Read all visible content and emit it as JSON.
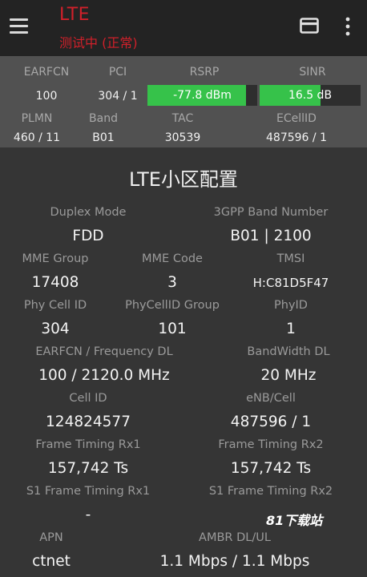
{
  "app": {
    "title": "LTE",
    "status": "测试中 (正常)"
  },
  "icons": {
    "menu": "hamburger-menu-icon",
    "sim": "sim-card-icon",
    "more": "more-vert-icon"
  },
  "colors": {
    "status_red": "#d0202a",
    "meter_green": "#36c24a"
  },
  "stats": {
    "earfcn_label": "EARFCN",
    "earfcn_value": "100",
    "pci_label": "PCI",
    "pci_value": "304 / 1",
    "rsrp_label": "RSRP",
    "rsrp_value": "-77.8 dBm",
    "rsrp_level": 0.9,
    "sinr_label": "SINR",
    "sinr_value": "16.5 dB",
    "sinr_level": 0.6,
    "plmn_label": "PLMN",
    "plmn_value": "460 / 11",
    "band_label": "Band",
    "band_value": "B01",
    "tac_label": "TAC",
    "tac_value": "30539",
    "ecellid_label": "ECellID",
    "ecellid_value": "487596 / 1"
  },
  "section": {
    "title": "LTE小区配置"
  },
  "fields": {
    "duplex_mode_label": "Duplex Mode",
    "duplex_mode_value": "FDD",
    "band_number_label": "3GPP Band Number",
    "band_number_value": "B01 | 2100",
    "mme_group_label": "MME Group",
    "mme_group_value": "17408",
    "mme_code_label": "MME Code",
    "mme_code_value": "3",
    "tmsi_label": "TMSI",
    "tmsi_value": "H:C81D5F47",
    "phy_cell_id_label": "Phy Cell ID",
    "phy_cell_id_value": "304",
    "phycellid_group_label": "PhyCellID Group",
    "phycellid_group_value": "101",
    "phyid_label": "PhyID",
    "phyid_value": "1",
    "earfcn_dl_label": "EARFCN / Frequency DL",
    "earfcn_dl_value": "100 / 2120.0 MHz",
    "bandwidth_dl_label": "BandWidth DL",
    "bandwidth_dl_value": "20 MHz",
    "cell_id_label": "Cell ID",
    "cell_id_value": "124824577",
    "enb_cell_label": "eNB/Cell",
    "enb_cell_value": "487596 / 1",
    "ft_rx1_label": "Frame Timing Rx1",
    "ft_rx1_value": "157,742 Ts",
    "ft_rx2_label": "Frame Timing Rx2",
    "ft_rx2_value": "157,742 Ts",
    "s1_ft_rx1_label": "S1 Frame Timing Rx1",
    "s1_ft_rx1_value": "-",
    "s1_ft_rx2_label": "S1 Frame Timing Rx2",
    "apn_label": "APN",
    "apn_value": "ctnet",
    "ambr_label": "AMBR DL/UL",
    "ambr_value": "1.1 Mbps / 1.1 Mbps"
  },
  "watermark": "81下载站"
}
